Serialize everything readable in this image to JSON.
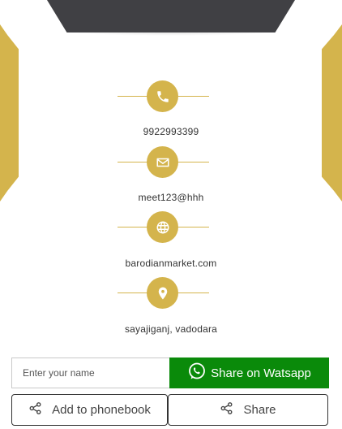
{
  "theme": {
    "gold": "#d4b44c",
    "dark": "#404044",
    "whatsapp_green": "#0a8a0a"
  },
  "contacts": [
    {
      "type": "phone",
      "icon": "phone-icon",
      "value": "9922993399"
    },
    {
      "type": "email",
      "icon": "envelope-icon",
      "value": "meet123@hhh"
    },
    {
      "type": "website",
      "icon": "globe-icon",
      "value": "barodianmarket.com"
    },
    {
      "type": "address",
      "icon": "location-pin-icon",
      "value": "sayajiganj, vadodara"
    }
  ],
  "share_form": {
    "name_placeholder": "Enter your name",
    "name_value": "",
    "whatsapp_label": "Share on Watsapp",
    "whatsapp_icon": "whatsapp-icon"
  },
  "actions": {
    "phonebook_label": "Add to phonebook",
    "share_label": "Share",
    "share_icon": "share-icon"
  }
}
